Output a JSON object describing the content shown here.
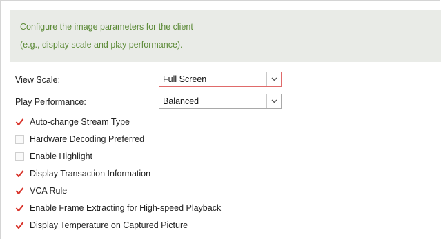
{
  "info": {
    "line1": "Configure the image parameters for the client",
    "line2": "(e.g., display scale and play performance)."
  },
  "view_scale": {
    "label": "View Scale:",
    "value": "Full Screen"
  },
  "play_performance": {
    "label": "Play Performance:",
    "value": "Balanced"
  },
  "options": [
    {
      "label": "Auto-change Stream Type",
      "checked": true
    },
    {
      "label": "Hardware Decoding Preferred",
      "checked": false
    },
    {
      "label": "Enable Highlight",
      "checked": false
    },
    {
      "label": "Display Transaction Information",
      "checked": true
    },
    {
      "label": "VCA Rule",
      "checked": true
    },
    {
      "label": "Enable Frame Extracting for High-speed Playback",
      "checked": true
    },
    {
      "label": "Display Temperature on Captured Picture",
      "checked": true
    }
  ],
  "colors": {
    "check": "#d9342b",
    "info_text": "#5c8a37",
    "info_bg": "#e9ebe7"
  }
}
